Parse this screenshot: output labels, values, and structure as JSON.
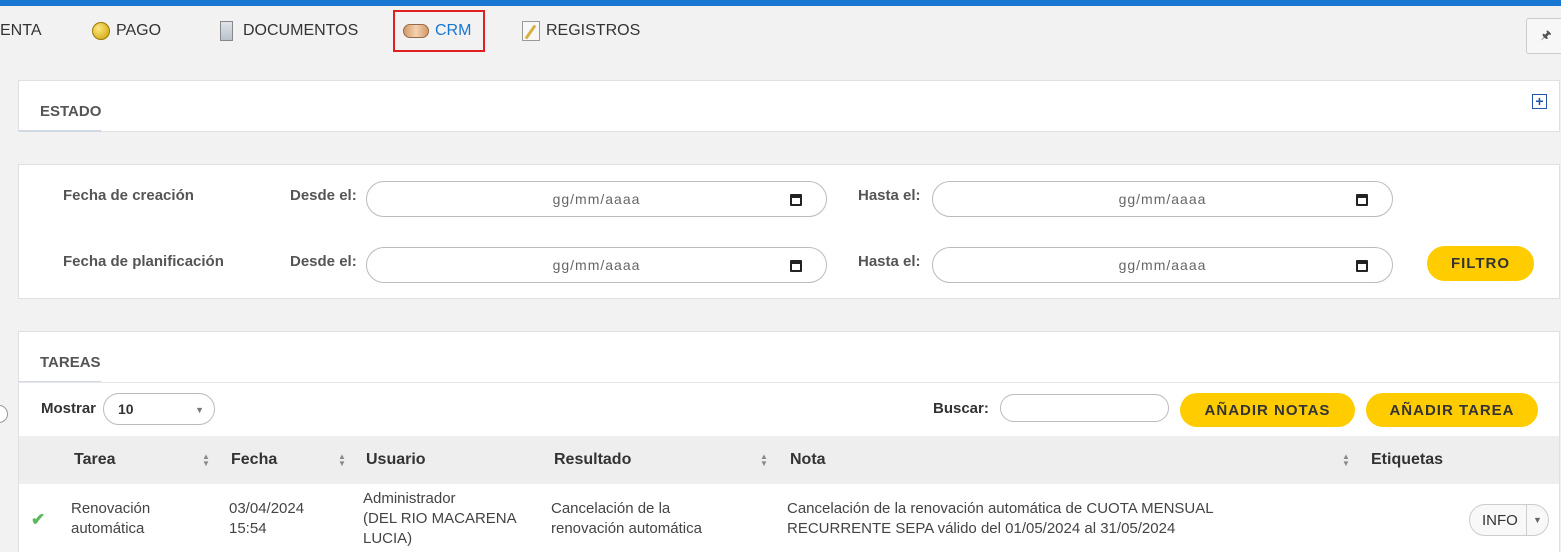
{
  "nav": {
    "items": [
      {
        "label": "ENTA",
        "icon": ""
      },
      {
        "label": "PAGO",
        "icon": "coin-icon"
      },
      {
        "label": "DOCUMENTOS",
        "icon": "document-icon"
      },
      {
        "label": "CRM",
        "icon": "handshake-icon"
      },
      {
        "label": "REGISTROS",
        "icon": "notepad-icon"
      }
    ],
    "active": "CRM",
    "pin_icon": "pin-icon",
    "pin_glyph": "🖈"
  },
  "estado": {
    "title": "ESTADO",
    "expand_glyph": "+"
  },
  "filters": {
    "row1_label": "Fecha de creación",
    "row2_label": "Fecha de planificación",
    "from_label": "Desde el:",
    "to_label": "Hasta el:",
    "date_placeholder": "gg/mm/aaaa",
    "filter_button": "FILTRO"
  },
  "tasks": {
    "title": "TAREAS",
    "show_label": "Mostrar",
    "show_value": "10",
    "search_label": "Buscar:",
    "search_value": "",
    "add_notes_button": "AÑADIR NOTAS",
    "add_task_button": "AÑADIR TAREA",
    "columns": [
      "Tarea",
      "Fecha",
      "Usuario",
      "Resultado",
      "Nota",
      "Etiquetas"
    ],
    "rows": [
      {
        "status_icon": "check-icon",
        "tarea": [
          "Renovación",
          "automática"
        ],
        "fecha": [
          "03/04/2024",
          "15:54"
        ],
        "usuario": [
          "Administrador",
          "(DEL RIO MACARENA",
          "LUCIA)"
        ],
        "resultado": [
          "Cancelación de la",
          "renovación automática"
        ],
        "nota": [
          "Cancelación de la renovación automática de CUOTA MENSUAL",
          "RECURRENTE SEPA válido del 01/05/2024 al 31/05/2024"
        ],
        "action": "INFO"
      }
    ]
  },
  "colors": {
    "accent": "#1877d2",
    "button_yellow": "#ffcc00",
    "active_border": "#e02020",
    "check": "#5cb85c"
  }
}
